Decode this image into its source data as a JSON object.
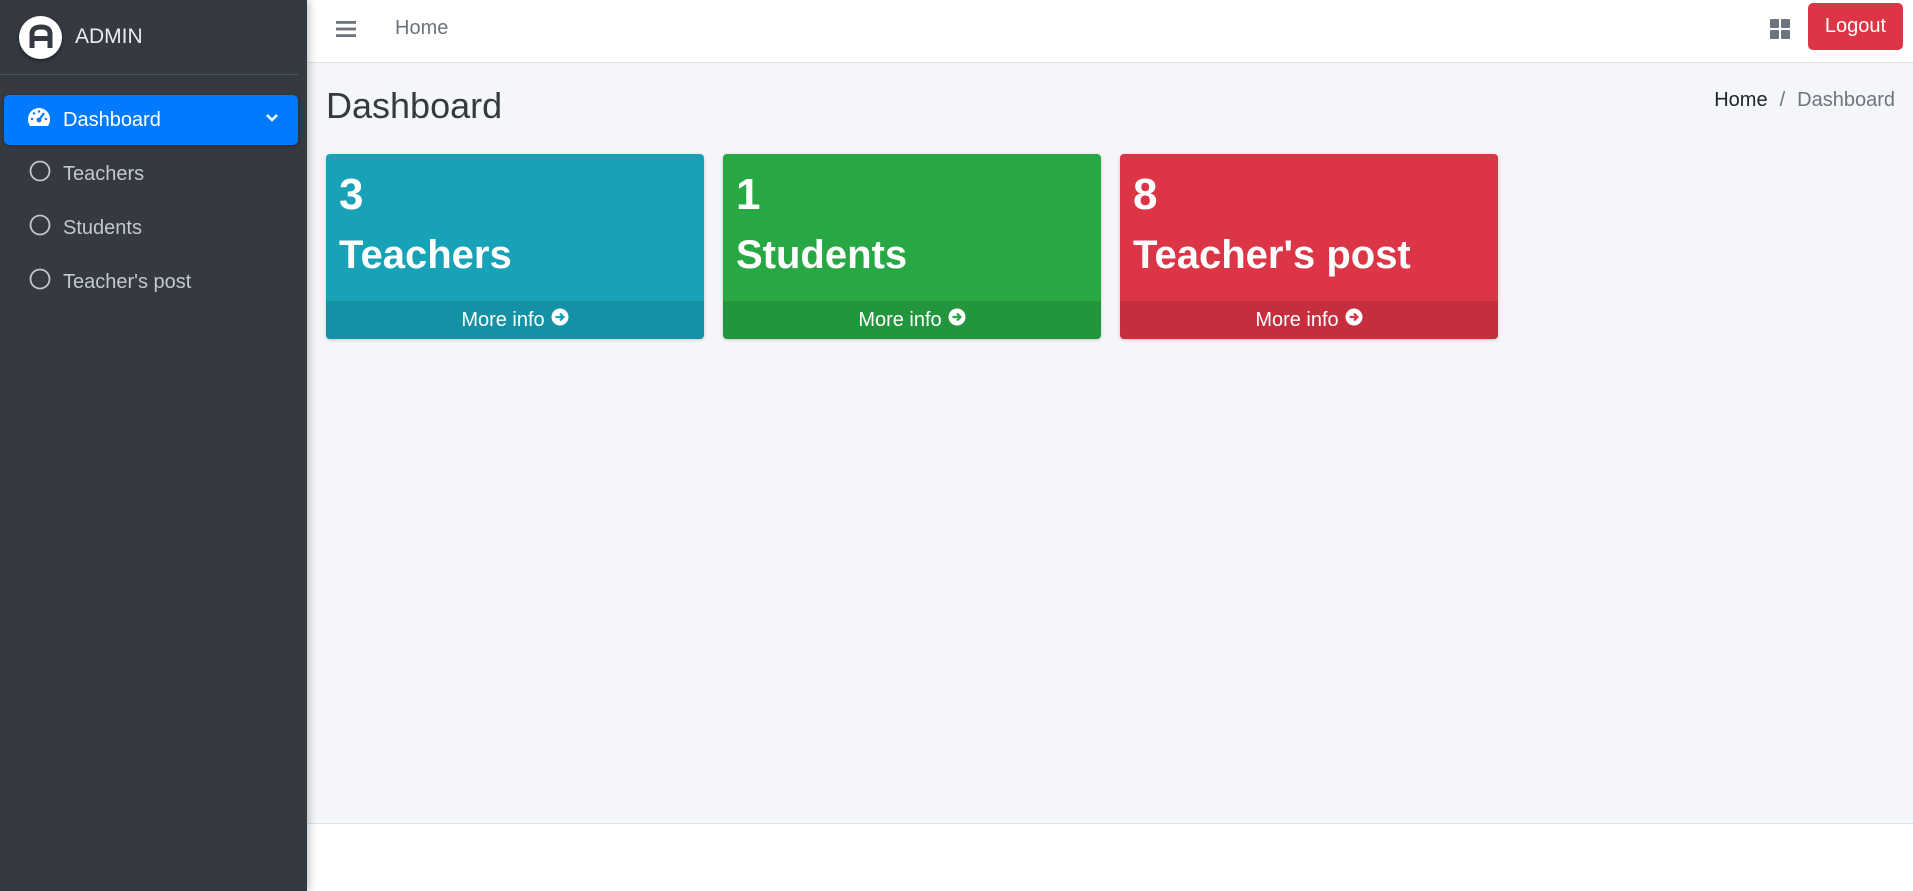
{
  "brand": {
    "name": "ADMIN",
    "logo_letter": "A",
    "icon": "admin-logo-icon"
  },
  "sidebar": {
    "items": [
      {
        "label": "Dashboard",
        "icon": "tachometer-icon",
        "active": true
      },
      {
        "label": "Teachers",
        "icon": "circle-icon",
        "active": false
      },
      {
        "label": "Students",
        "icon": "circle-icon",
        "active": false
      },
      {
        "label": "Teacher's post",
        "icon": "circle-icon",
        "active": false
      }
    ]
  },
  "topbar": {
    "home_link": "Home",
    "logout_label": "Logout"
  },
  "page": {
    "title": "Dashboard",
    "breadcrumb": {
      "home": "Home",
      "separator": "/",
      "current": "Dashboard"
    }
  },
  "cards": [
    {
      "count": "3",
      "title": "Teachers",
      "more": "More info",
      "color": "#17a2b8"
    },
    {
      "count": "1",
      "title": "Students",
      "more": "More info",
      "color": "#28a745"
    },
    {
      "count": "8",
      "title": "Teacher's post",
      "more": "More info",
      "color": "#dc3545"
    }
  ],
  "colors": {
    "sidebar_bg": "#343a40",
    "active_nav": "#007bff",
    "content_bg": "#f4f6f9",
    "logout": "#dc3545"
  }
}
